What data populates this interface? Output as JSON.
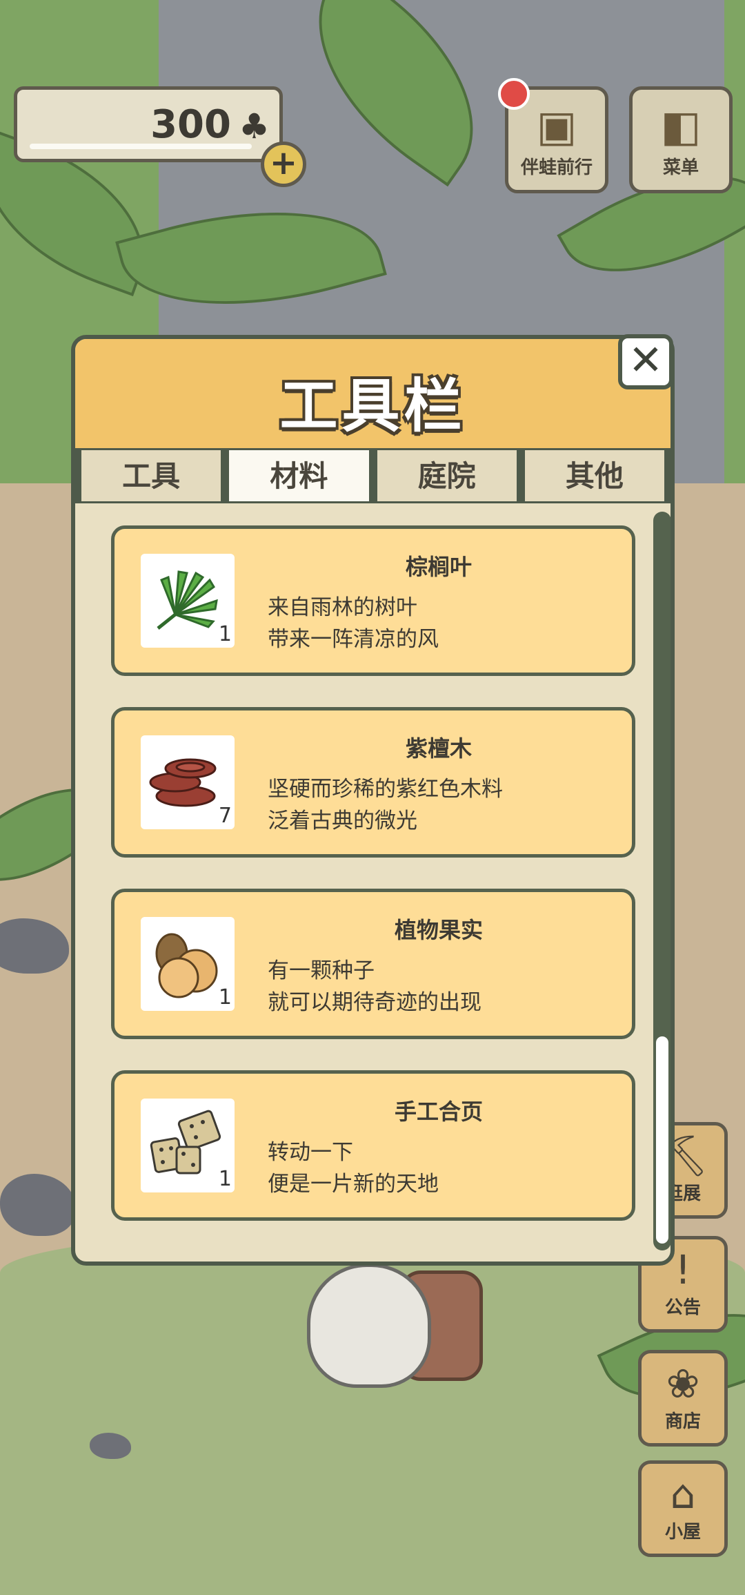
{
  "hud": {
    "clover_count": "300",
    "clover_icon": "clover-icon",
    "add_icon": "plus-icon"
  },
  "top_buttons": [
    {
      "label": "伴蛙前行",
      "icon": "journal-icon"
    },
    {
      "label": "菜单",
      "icon": "menu-cards-icon"
    }
  ],
  "side_buttons": [
    {
      "label": "逛展",
      "icon": "pickaxe-icon"
    },
    {
      "label": "公告",
      "icon": "exclamation-icon"
    },
    {
      "label": "商店",
      "icon": "shop-bags-icon"
    },
    {
      "label": "小屋",
      "icon": "house-icon"
    }
  ],
  "panel": {
    "title": "工具栏",
    "tabs": [
      "工具",
      "材料",
      "庭院",
      "其他"
    ],
    "active_tab": "材料",
    "items": [
      {
        "name": "棕榈叶",
        "line1": "来自雨林的树叶",
        "line2": "带来一阵清凉的风",
        "qty": "1",
        "icon": "palm-leaf-icon"
      },
      {
        "name": "紫檀木",
        "line1": "坚硬而珍稀的紫红色木料",
        "line2": "泛着古典的微光",
        "qty": "7",
        "icon": "rosewood-logs-icon"
      },
      {
        "name": "植物果实",
        "line1": "有一颗种子",
        "line2": "就可以期待奇迹的出现",
        "qty": "1",
        "icon": "fruit-seeds-icon"
      },
      {
        "name": "手工合页",
        "line1": "转动一下",
        "line2": "便是一片新的天地",
        "qty": "1",
        "icon": "hinges-icon"
      }
    ]
  },
  "colors": {
    "panel_header": "#f2c46a",
    "card_bg": "#fedd97",
    "panel_bg": "#e9e0c3",
    "outline": "#4e5a4a"
  }
}
